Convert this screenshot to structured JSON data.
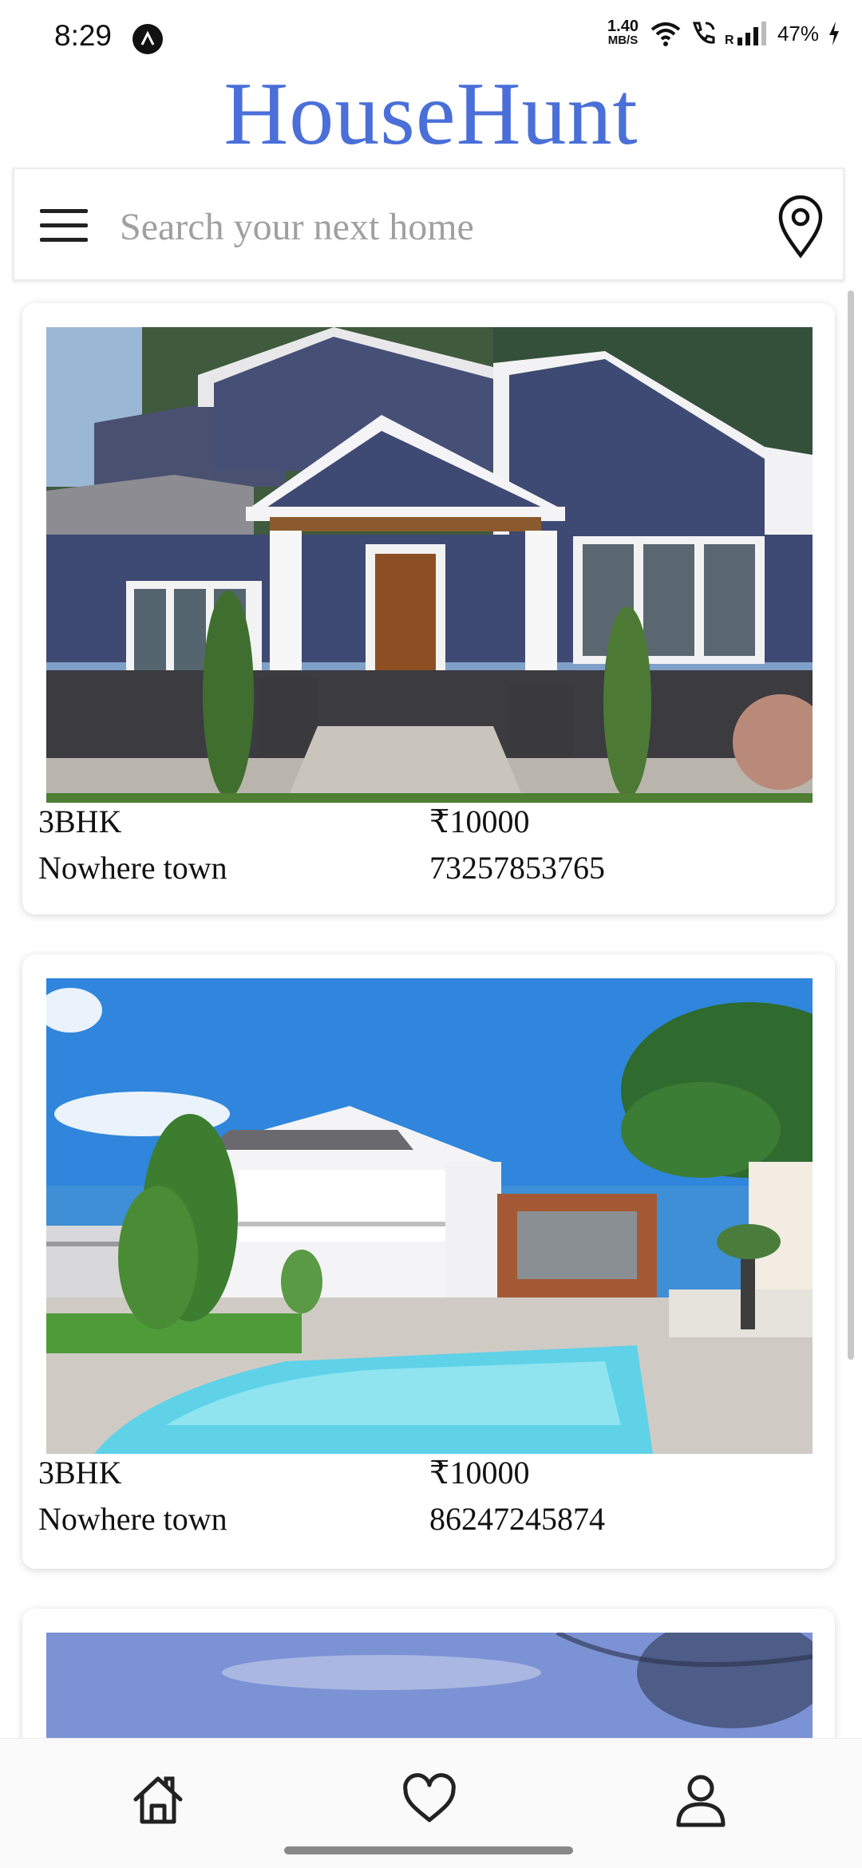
{
  "status_bar": {
    "time": "8:29",
    "net_speed_value": "1.40",
    "net_speed_unit": "MB/S",
    "battery_percent": "47%",
    "icons": [
      "wifi-icon",
      "wifi-call-icon",
      "signal-icon",
      "battery-charging-icon"
    ]
  },
  "app": {
    "title": "HouseHunt"
  },
  "search": {
    "placeholder": "Search your next home",
    "value": ""
  },
  "listings": [
    {
      "type": "3BHK",
      "price": "₹10000",
      "location": "Nowhere town",
      "phone": "73257853765"
    },
    {
      "type": "3BHK",
      "price": "₹10000",
      "location": "Nowhere town",
      "phone": "86247245874"
    }
  ],
  "bottom_nav": {
    "items": [
      "home-icon",
      "heart-icon",
      "profile-icon"
    ]
  },
  "colors": {
    "title": "#4a6fd8",
    "placeholder": "#a0a0a0"
  }
}
